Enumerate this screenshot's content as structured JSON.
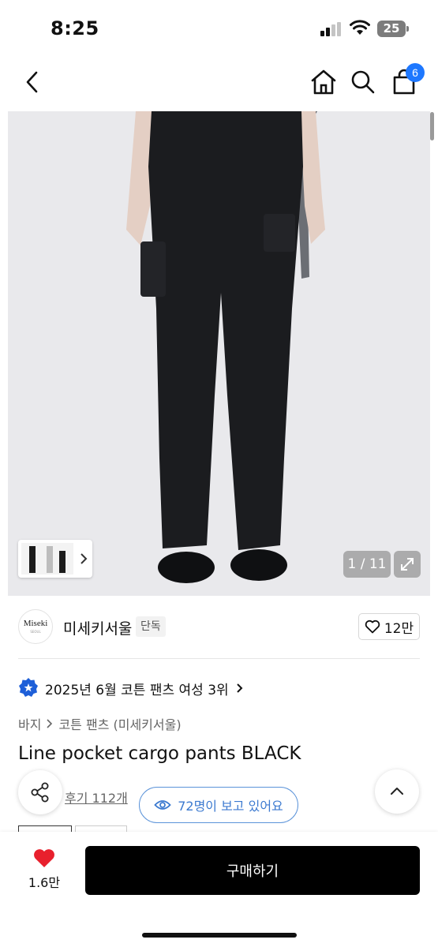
{
  "status_bar": {
    "time": "8:25",
    "battery": "25"
  },
  "nav": {
    "cart_count": "6"
  },
  "gallery": {
    "counter": "1 / 11"
  },
  "store": {
    "logo_text": "Miseki",
    "logo_sub": "SEOUL",
    "name": "미세키서울",
    "tag": "단독",
    "likes": "12만"
  },
  "ranking": {
    "text": "2025년 6월 코튼 팬츠 여성 3위"
  },
  "breadcrumb": {
    "category": "바지",
    "subcategory": "코튼 팬츠 (미세키서울)"
  },
  "product": {
    "title": "Line pocket cargo pants BLACK"
  },
  "reviews": {
    "label": "후기 112개"
  },
  "viewers": {
    "label": "72명이 보고 있어요"
  },
  "bottom_bar": {
    "wish_count": "1.6만",
    "buy_label": "구매하기"
  },
  "colors": {
    "accent": "#1e78ff",
    "heart": "#e8202d",
    "buy_button": "#000000",
    "viewers_pill": "#3c7ad0"
  }
}
